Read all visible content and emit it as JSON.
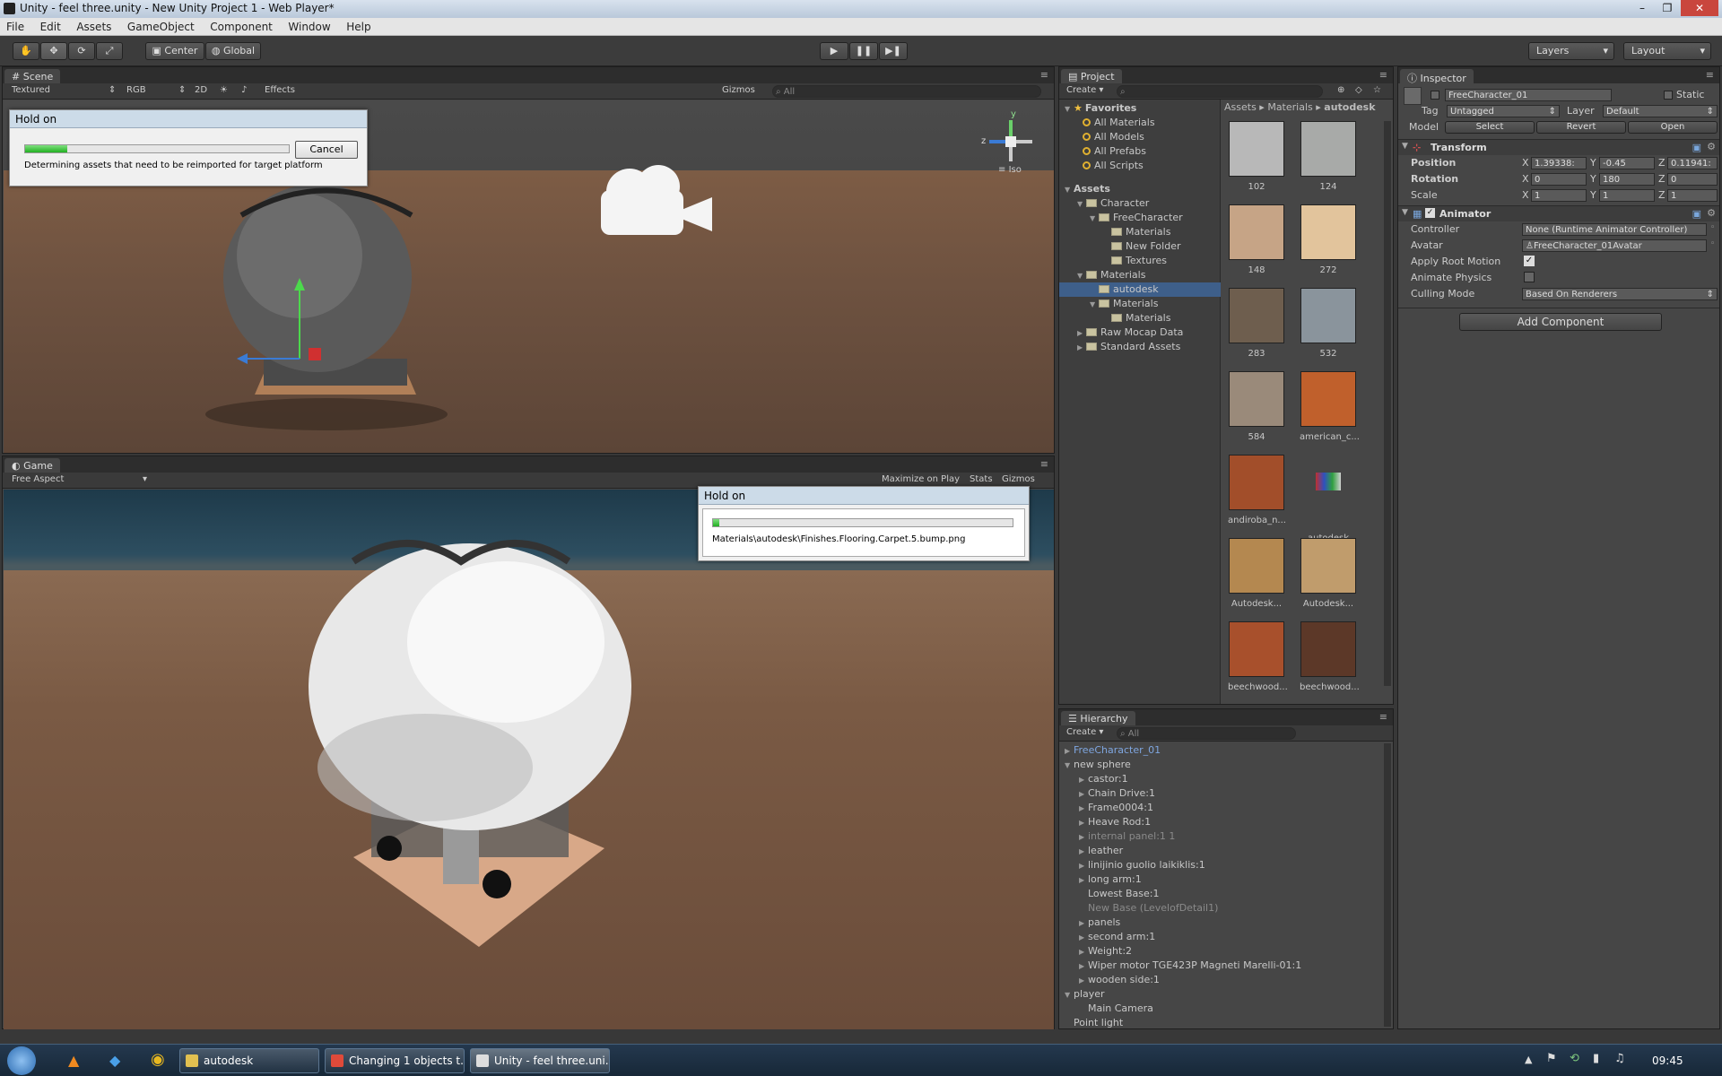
{
  "window": {
    "title": "Unity - feel three.unity - New Unity Project 1 - Web Player*",
    "minimize": "–",
    "maximize": "❐",
    "close": "✕"
  },
  "menu": [
    "File",
    "Edit",
    "Assets",
    "GameObject",
    "Component",
    "Window",
    "Help"
  ],
  "toolbar": {
    "pivot": "Center",
    "space": "Global",
    "layers": "Layers",
    "layout": "Layout"
  },
  "scene": {
    "tab": "Scene",
    "render_mode": "Textured",
    "color_mode": "RGB",
    "mode_2d": "2D",
    "effects": "Effects",
    "gizmos": "Gizmos",
    "search": "All",
    "projection": "Iso",
    "axis_x": "x",
    "axis_y": "y",
    "axis_z": "z"
  },
  "game": {
    "tab": "Game",
    "aspect": "Free Aspect",
    "maximize": "Maximize on Play",
    "stats": "Stats",
    "gizmos": "Gizmos"
  },
  "dialog1": {
    "title": "Hold on",
    "message": "Determining assets that need to be reimported for target platform",
    "cancel": "Cancel",
    "progress": 0.16
  },
  "dialog2": {
    "title": "Hold on",
    "message": "Materials\\autodesk\\Finishes.Flooring.Carpet.5.bump.png",
    "progress": 0.02
  },
  "project": {
    "tab": "Project",
    "create": "Create",
    "favorites_label": "Favorites",
    "favorites": [
      "All Materials",
      "All Models",
      "All Prefabs",
      "All Scripts"
    ],
    "assets_label": "Assets",
    "tree": [
      {
        "label": "Character",
        "depth": 1
      },
      {
        "label": "FreeCharacter",
        "depth": 2
      },
      {
        "label": "Materials",
        "depth": 3
      },
      {
        "label": "New Folder",
        "depth": 3
      },
      {
        "label": "Textures",
        "depth": 3
      },
      {
        "label": "Materials",
        "depth": 1
      },
      {
        "label": "autodesk",
        "depth": 2
      },
      {
        "label": "Materials",
        "depth": 2
      },
      {
        "label": "Materials",
        "depth": 3
      },
      {
        "label": "Raw Mocap Data",
        "depth": 1
      },
      {
        "label": "Standard Assets",
        "depth": 1
      }
    ],
    "breadcrumb": [
      "Assets",
      "Materials",
      "autodesk"
    ],
    "assets": [
      {
        "label": "102",
        "color": "#b8b8b8"
      },
      {
        "label": "124",
        "color": "#a8aaa8"
      },
      {
        "label": "148",
        "color": "#c6a486"
      },
      {
        "label": "272",
        "color": "#e2c49c"
      },
      {
        "label": "283",
        "color": "#6e5e4e"
      },
      {
        "label": "532",
        "color": "#8a949c"
      },
      {
        "label": "584",
        "color": "#9a8a7a"
      },
      {
        "label": "american_c...",
        "color": "#c0602c"
      },
      {
        "label": "andiroba_n...",
        "color": "#a24e2a"
      },
      {
        "label": "autodesk",
        "color": "#464646"
      },
      {
        "label": "Autodesk...",
        "color": "#b48850"
      },
      {
        "label": "Autodesk...",
        "color": "#c09c6c"
      },
      {
        "label": "beechwood...",
        "color": "#a8502c"
      },
      {
        "label": "beechwood...",
        "color": "#5c3828"
      }
    ]
  },
  "hierarchy": {
    "tab": "Hierarchy",
    "create": "Create",
    "search": "All",
    "rows": [
      {
        "label": "FreeCharacter_01",
        "depth": 0,
        "toggle": "▶",
        "style": "blue"
      },
      {
        "label": "new sphere",
        "depth": 0,
        "toggle": "▼",
        "style": "normal"
      },
      {
        "label": "castor:1",
        "depth": 1,
        "toggle": "▶",
        "style": "normal"
      },
      {
        "label": "Chain Drive:1",
        "depth": 1,
        "toggle": "▶",
        "style": "normal"
      },
      {
        "label": "Frame0004:1",
        "depth": 1,
        "toggle": "▶",
        "style": "normal"
      },
      {
        "label": "Heave Rod:1",
        "depth": 1,
        "toggle": "▶",
        "style": "normal"
      },
      {
        "label": "internal panel:1 1",
        "depth": 1,
        "toggle": "▶",
        "style": "dim"
      },
      {
        "label": "leather",
        "depth": 1,
        "toggle": "▶",
        "style": "normal"
      },
      {
        "label": "linijinio guolio laikiklis:1",
        "depth": 1,
        "toggle": "▶",
        "style": "normal"
      },
      {
        "label": "long arm:1",
        "depth": 1,
        "toggle": "▶",
        "style": "normal"
      },
      {
        "label": "Lowest Base:1",
        "depth": 1,
        "toggle": "",
        "style": "normal"
      },
      {
        "label": "New Base (LevelofDetail1)",
        "depth": 1,
        "toggle": "",
        "style": "dim"
      },
      {
        "label": "panels",
        "depth": 1,
        "toggle": "▶",
        "style": "normal"
      },
      {
        "label": "second arm:1",
        "depth": 1,
        "toggle": "▶",
        "style": "normal"
      },
      {
        "label": "Weight:2",
        "depth": 1,
        "toggle": "▶",
        "style": "normal"
      },
      {
        "label": "Wiper motor TGE423P Magneti Marelli-01:1",
        "depth": 1,
        "toggle": "▶",
        "style": "normal"
      },
      {
        "label": "wooden side:1",
        "depth": 1,
        "toggle": "▶",
        "style": "normal"
      },
      {
        "label": "player",
        "depth": 0,
        "toggle": "▼",
        "style": "normal"
      },
      {
        "label": "Main Camera",
        "depth": 1,
        "toggle": "",
        "style": "normal"
      },
      {
        "label": "Point light",
        "depth": 0,
        "toggle": "",
        "style": "normal"
      }
    ]
  },
  "inspector": {
    "tab": "Inspector",
    "object_name": "FreeCharacter_01",
    "static": "Static",
    "tag_label": "Tag",
    "tag": "Untagged",
    "layer_label": "Layer",
    "layer": "Default",
    "model_label": "Model",
    "model_select": "Select",
    "model_revert": "Revert",
    "model_open": "Open",
    "transform": {
      "title": "Transform",
      "position_label": "Position",
      "rotation_label": "Rotation",
      "scale_label": "Scale",
      "x": "X",
      "y": "Y",
      "z": "Z",
      "position": [
        "1.39338:",
        "-0.45",
        "0.11941:"
      ],
      "rotation": [
        "0",
        "180",
        "0"
      ],
      "scale": [
        "1",
        "1",
        "1"
      ]
    },
    "animator": {
      "title": "Animator",
      "controller_label": "Controller",
      "controller": "None (Runtime Animator Controller)",
      "avatar_label": "Avatar",
      "avatar": "FreeCharacter_01Avatar",
      "root_motion_label": "Apply Root Motion",
      "physics_label": "Animate Physics",
      "culling_label": "Culling Mode",
      "culling": "Based On Renderers"
    },
    "add_component": "Add Component"
  },
  "taskbar": {
    "items": [
      {
        "label": "autodesk",
        "color": "#e2c050"
      },
      {
        "label": "Changing 1 objects t...",
        "color": "#e04a3a"
      },
      {
        "label": "Unity - feel three.uni...",
        "color": "#dddddd"
      }
    ],
    "clock": "09:45"
  }
}
